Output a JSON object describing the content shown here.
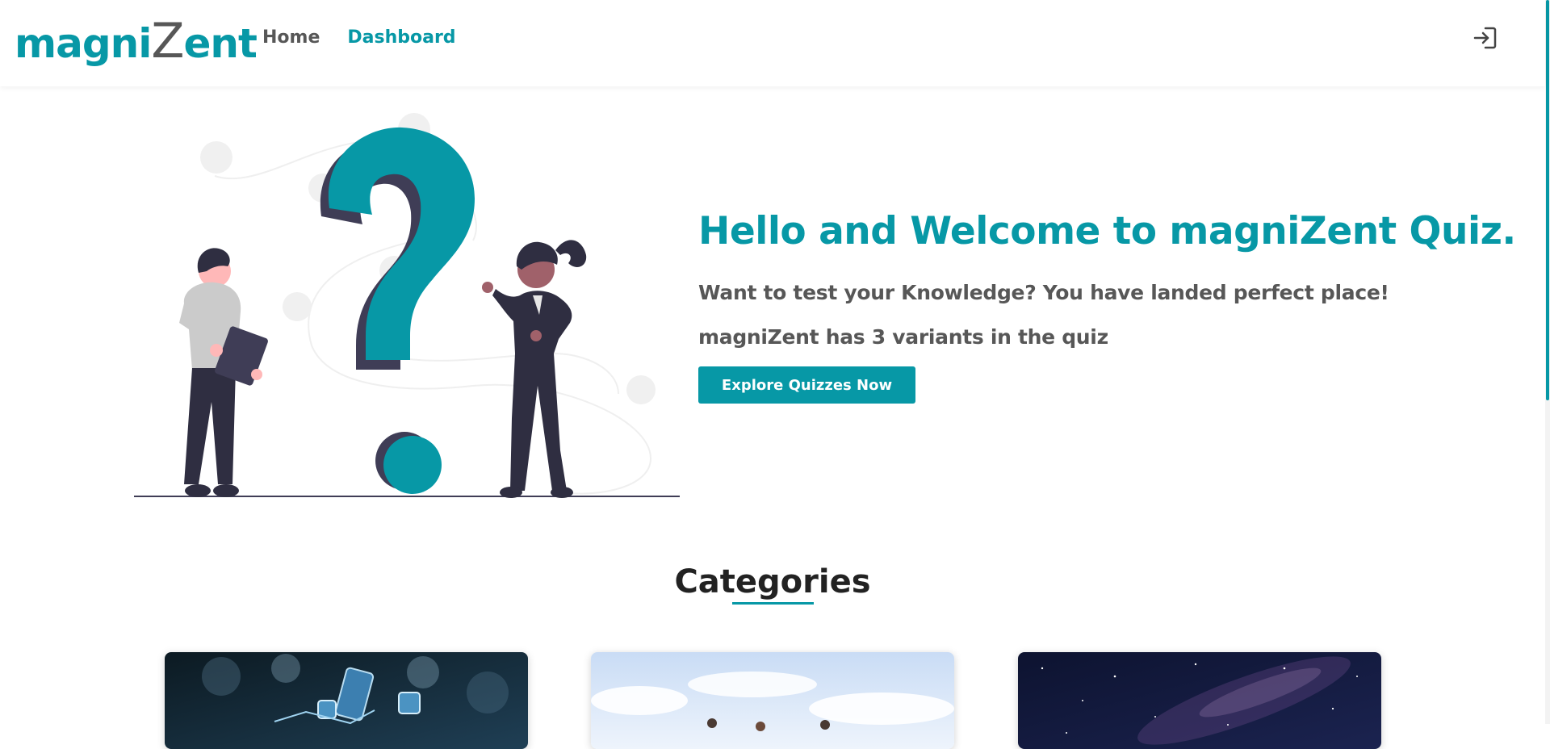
{
  "header": {
    "logo": {
      "part1": "magni",
      "part2": "Z",
      "part3": "ent"
    },
    "nav": [
      {
        "label": "Home",
        "active": false
      },
      {
        "label": "Dashboard",
        "active": true
      }
    ],
    "login_icon": "login-icon"
  },
  "hero": {
    "illustration_icon": "question-mark-people-illustration",
    "title": "Hello and Welcome to magniZent Quiz.",
    "subtitle": "Want to test your Knowledge? You have landed perfect place!",
    "variants_text": "magniZent has 3 variants in the quiz",
    "cta_label": "Explore Quizzes Now"
  },
  "categories": {
    "title": "Categories",
    "cards": [
      {
        "image": "technology-devices-image"
      },
      {
        "image": "sky-people-image"
      },
      {
        "image": "night-sky-galaxy-image"
      }
    ]
  },
  "colors": {
    "accent": "#0798a6",
    "text_dark": "#575757",
    "heading": "#222222",
    "figure_dark": "#2f2e41"
  }
}
